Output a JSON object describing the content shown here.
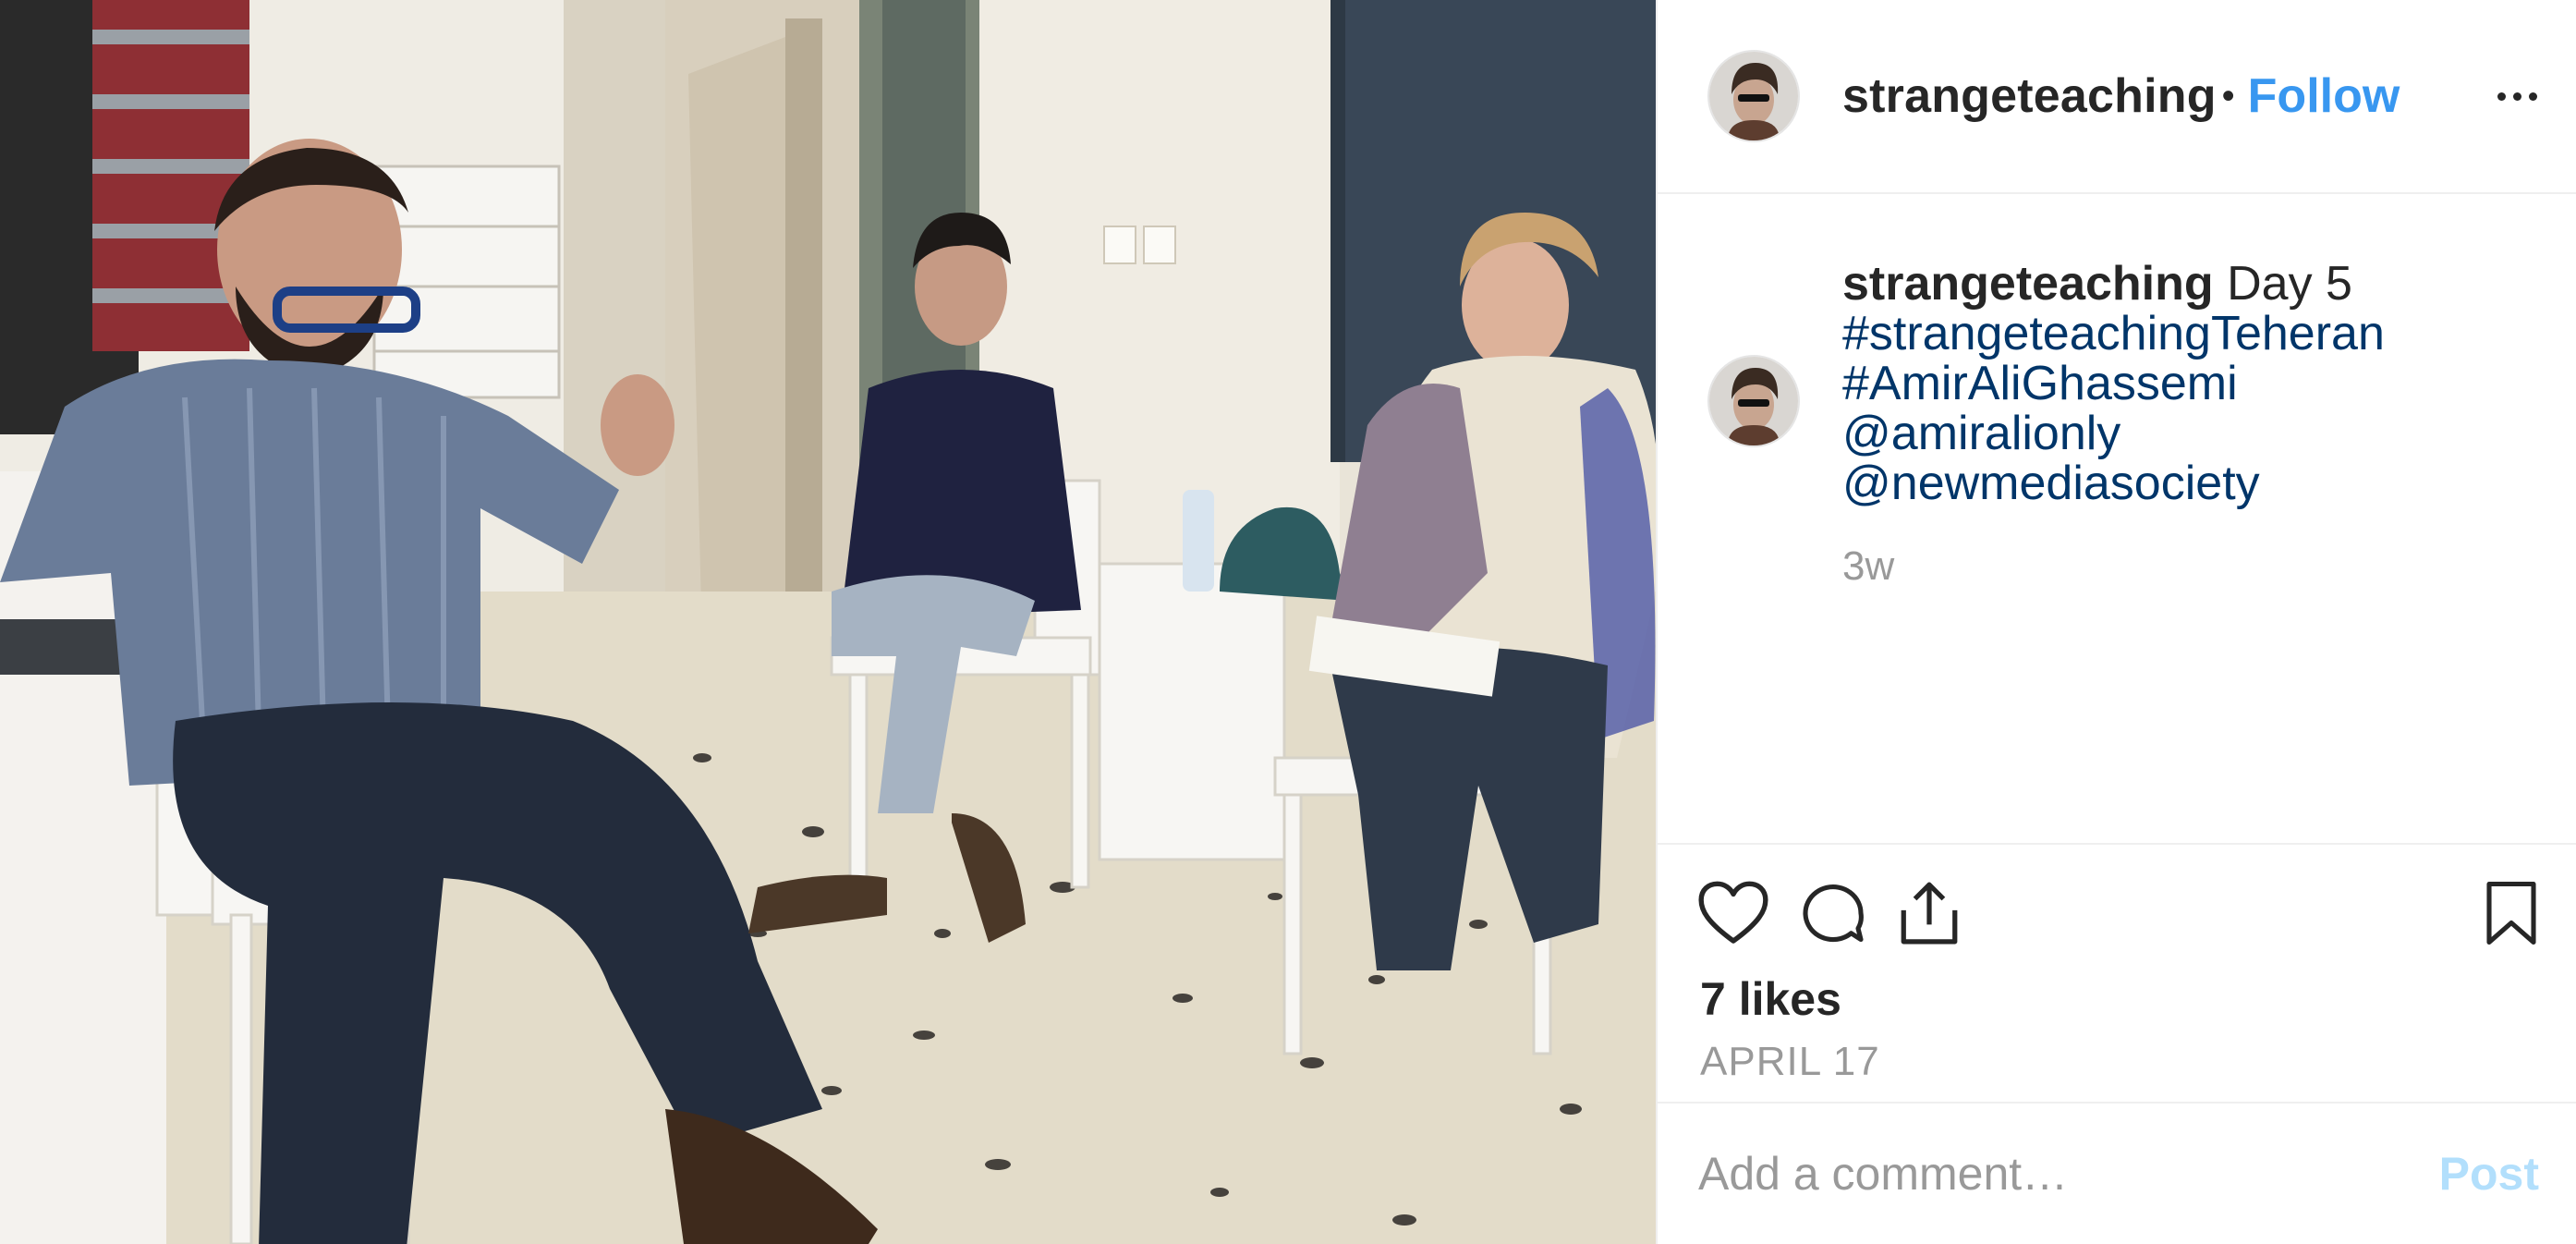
{
  "photo": {
    "alt_icon": "photo-image"
  },
  "header": {
    "username": "strangeteaching",
    "separator": "•",
    "follow_label": "Follow",
    "more_icon": "more-horizontal-icon"
  },
  "caption": {
    "username": "strangeteaching",
    "text": "Day 5",
    "tags": [
      "#strangeteachingTeheran",
      "#AmirAliGhassemi",
      "@amiralionly",
      "@newmediasociety"
    ],
    "time": "3w"
  },
  "actions": {
    "like_icon": "heart-icon",
    "comment_icon": "comment-icon",
    "share_icon": "share-icon",
    "save_icon": "bookmark-icon",
    "likes": "7 likes",
    "date": "APRIL 17"
  },
  "comment_box": {
    "placeholder": "Add a comment…",
    "post_label": "Post"
  },
  "colors": {
    "link_blue": "#3897f0",
    "hashtag_blue": "#003569",
    "muted_gray": "#999999",
    "post_disabled": "#b2dffc"
  }
}
